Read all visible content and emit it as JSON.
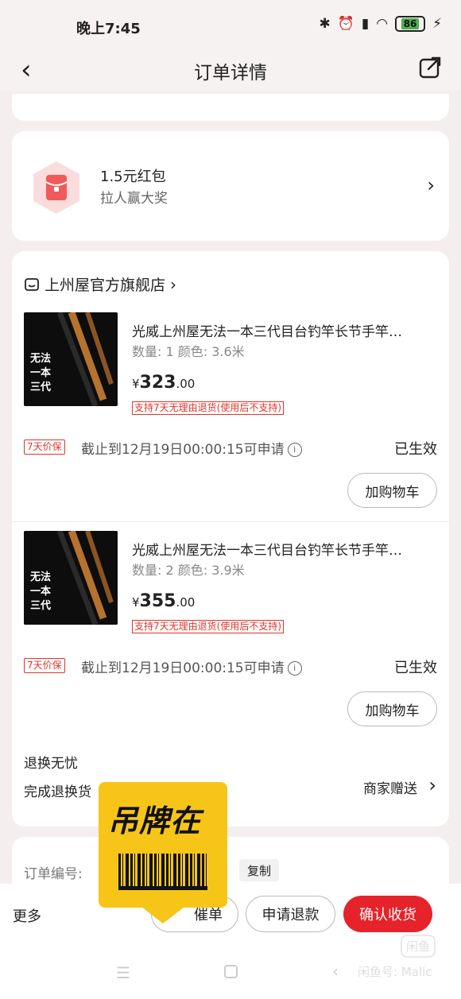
{
  "status": {
    "time": "晚上7:45",
    "battery": "86"
  },
  "nav": {
    "title": "订单详情"
  },
  "red_packet": {
    "title": "1.5元红包",
    "subtitle": "拉人赢大奖"
  },
  "store": {
    "name": "上州屋官方旗舰店"
  },
  "products": [
    {
      "title": "光威上州屋无法一本三代目台钓竿长节手竿…",
      "spec": "数量: 1  颜色: 3.6米",
      "price_currency": "¥",
      "price_int": "323",
      "price_dec": ".00",
      "return_tag": "支持7天无理由退货(使用后不支持)",
      "guard_badge": "7天价保",
      "guard_text": "截止到12月19日00:00:15可申请",
      "guard_status": "已生效",
      "add_cart_label": "加购物车"
    },
    {
      "title": "光威上州屋无法一本三代目台钓竿长节手竿…",
      "spec": "数量: 2  颜色: 3.9米",
      "price_currency": "¥",
      "price_int": "355",
      "price_dec": ".00",
      "return_tag": "支持7天无理由退货(使用后不支持)",
      "guard_badge": "7天价保",
      "guard_text": "截止到12月19日00:00:15可申请",
      "guard_status": "已生效",
      "add_cart_label": "加购物车"
    }
  ],
  "after_sale": {
    "title": "退换无忧",
    "subtitle": "完成退换货",
    "gift": "商家赠送"
  },
  "order_info": {
    "order_no_label": "订单编号:",
    "copy_label": "复制"
  },
  "bottom": {
    "more": "更多",
    "remind": "催单",
    "refund": "申请退款",
    "confirm": "确认收货"
  },
  "sticker": {
    "text": "吊牌在"
  },
  "watermark": {
    "text": "闲鱼号: Malic",
    "logo": "闲鱼"
  },
  "colors": {
    "accent": "#e6232a",
    "page_bg": "#f4eeee",
    "sticker": "#f6c517"
  }
}
